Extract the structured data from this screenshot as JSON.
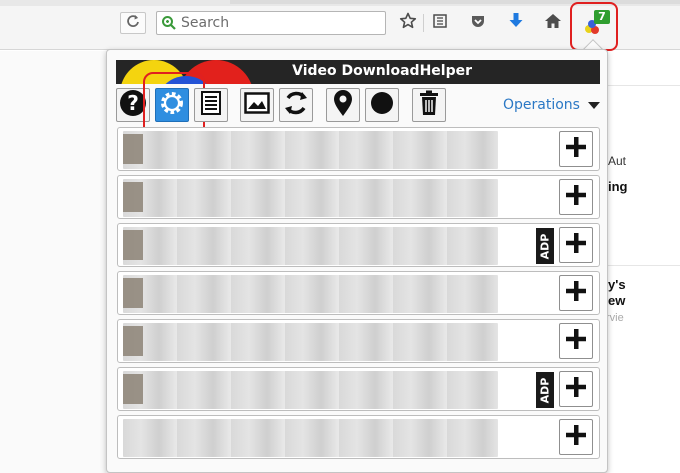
{
  "toolbar": {
    "search": {
      "placeholder": "Search"
    },
    "extension": {
      "badge_count": "7",
      "highlight_color": "#e02020"
    },
    "icons": [
      "reload-icon",
      "search-engine-icon",
      "bookmark-star-icon",
      "reader-list-icon",
      "pocket-icon",
      "downloads-arrow-icon",
      "home-icon",
      "video-downloadhelper-icon"
    ]
  },
  "background_page": {
    "snippets": [
      "Aut",
      "ing",
      "y's",
      "ew",
      "rvie"
    ]
  },
  "panel": {
    "title": "Video DownloadHelper",
    "toolbar": {
      "buttons": [
        "help-icon",
        "settings-gear-icon",
        "log-list-icon",
        "image-icon",
        "convert-recycle-icon",
        "location-pin-icon",
        "record-dot-icon",
        "trash-icon"
      ],
      "selected": "settings-gear-icon",
      "operations_label": "Operations"
    },
    "accent_color": "#2f8ee0",
    "items": [
      {
        "adp_label": ""
      },
      {
        "adp_label": ""
      },
      {
        "adp_label": "ADP"
      },
      {
        "adp_label": ""
      },
      {
        "adp_label": ""
      },
      {
        "adp_label": "ADP"
      },
      {
        "adp_label": ""
      }
    ]
  }
}
